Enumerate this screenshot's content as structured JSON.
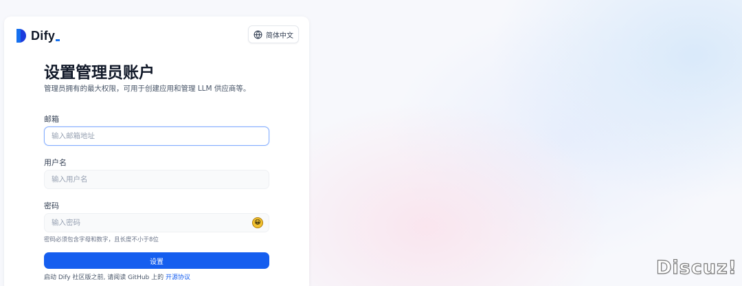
{
  "brand": {
    "name": "Dify"
  },
  "language_button": {
    "label": "简体中文",
    "icon": "globe-icon"
  },
  "page": {
    "title": "设置管理员账户",
    "subtitle": "管理员拥有的最大权限，可用于创建应用和管理 LLM 供应商等。"
  },
  "form": {
    "email": {
      "label": "邮箱",
      "placeholder": "输入邮箱地址",
      "value": ""
    },
    "username": {
      "label": "用户名",
      "placeholder": "输入用户名",
      "value": ""
    },
    "password": {
      "label": "密码",
      "placeholder": "输入密码",
      "value": "",
      "toggle_icon": "emoji-face-icon",
      "toggle_glyph": "😀"
    },
    "password_hint": "密码必须包含字母和数字，且长度不小于8位",
    "submit_label": "设置"
  },
  "footer": {
    "text": "启动 Dify 社区版之前, 请阅读 GitHub 上的",
    "link": "开源协议"
  },
  "watermark": "Discuz!",
  "colors": {
    "primary": "#155eef",
    "logo": "#1c3cdd",
    "text": "#101828"
  }
}
